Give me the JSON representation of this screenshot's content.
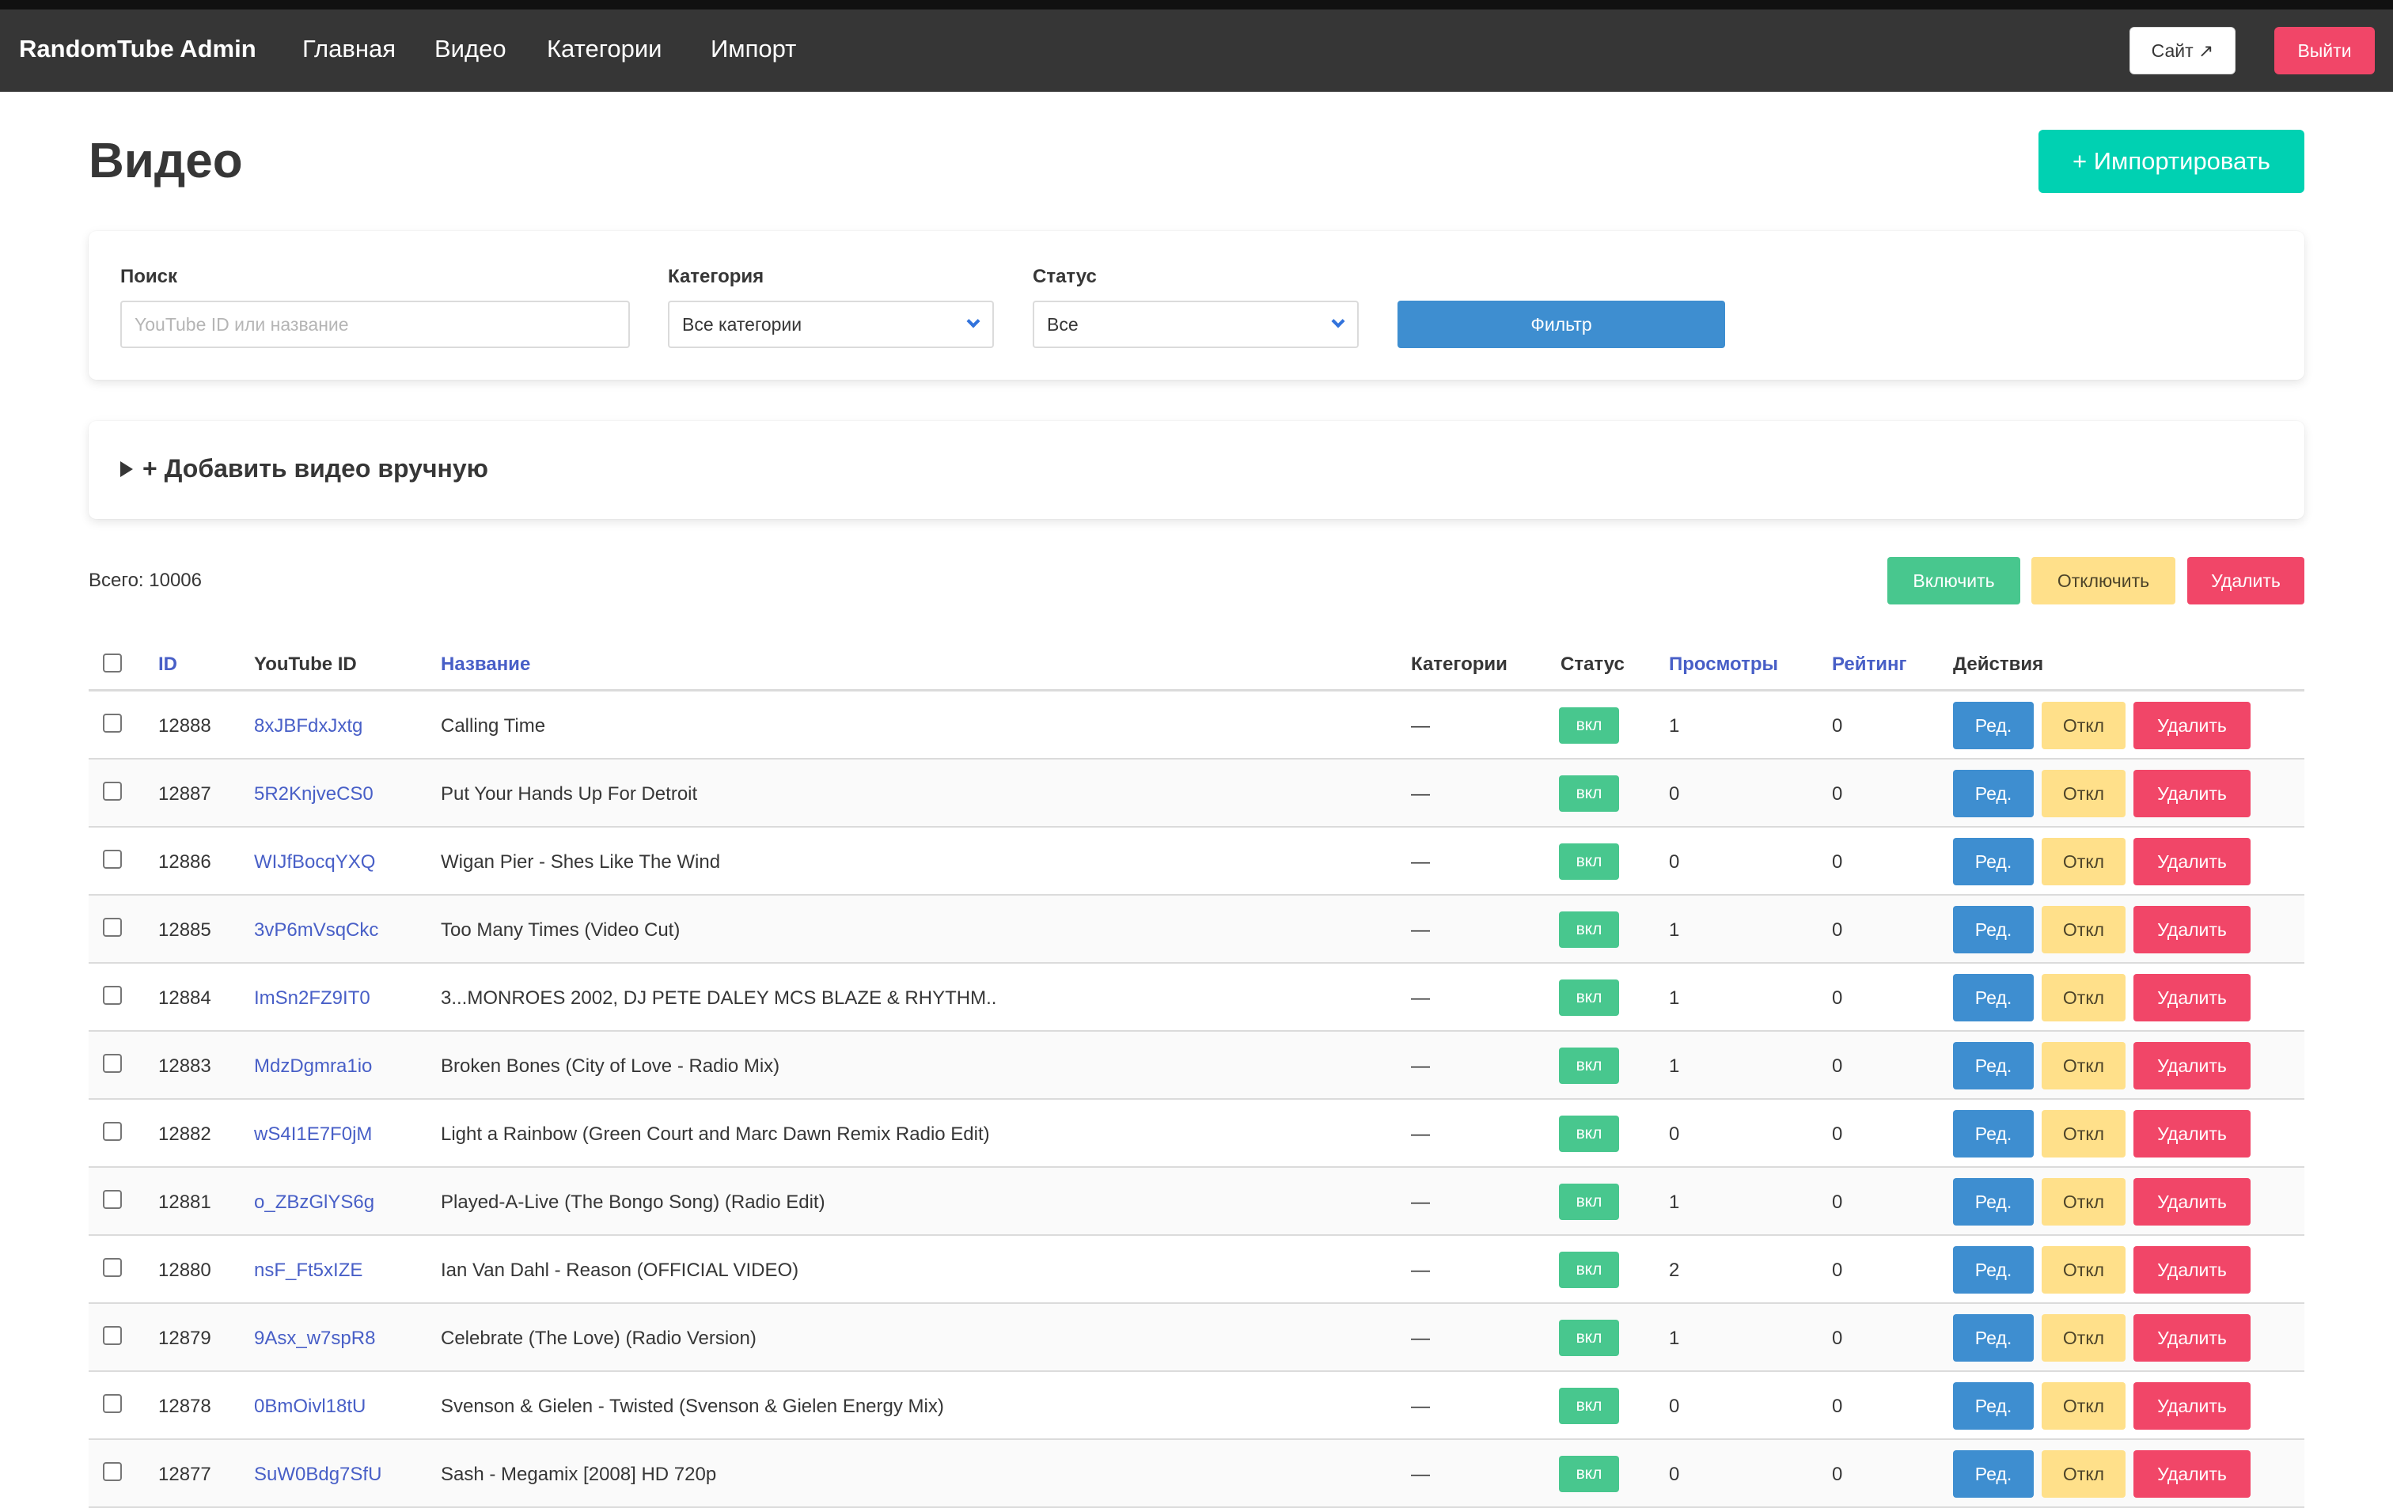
{
  "navbar": {
    "brand": "RandomTube Admin",
    "links": [
      "Главная",
      "Видео",
      "Категории",
      "Импорт"
    ],
    "site_button": "Сайт ↗",
    "logout_button": "Выйти"
  },
  "page": {
    "title": "Видео",
    "import_button": "+ Импортировать"
  },
  "filters": {
    "search_label": "Поиск",
    "search_placeholder": "YouTube ID или название",
    "category_label": "Категория",
    "category_value": "Все категории",
    "status_label": "Статус",
    "status_value": "Все",
    "filter_button": "Фильтр"
  },
  "add_manual": {
    "summary": "+ Добавить видео вручную"
  },
  "total": "Всего: 10006",
  "bulk": {
    "enable": "Включить",
    "disable": "Отключить",
    "delete": "Удалить"
  },
  "table": {
    "headers": {
      "id": "ID",
      "youtube_id": "YouTube ID",
      "title": "Название",
      "categories": "Категории",
      "status": "Статус",
      "views": "Просмотры",
      "rating": "Рейтинг",
      "actions": "Действия"
    },
    "action_labels": {
      "edit": "Ред.",
      "disable": "Откл",
      "delete": "Удалить"
    },
    "rows": [
      {
        "id": "12888",
        "yt": "8xJBFdxJxtg",
        "title": "Calling Time",
        "categories": "—",
        "status": "вкл",
        "views": "1",
        "rating": "0"
      },
      {
        "id": "12887",
        "yt": "5R2KnjveCS0",
        "title": "Put Your Hands Up For Detroit",
        "categories": "—",
        "status": "вкл",
        "views": "0",
        "rating": "0"
      },
      {
        "id": "12886",
        "yt": "WIJfBocqYXQ",
        "title": "Wigan Pier - Shes Like The Wind",
        "categories": "—",
        "status": "вкл",
        "views": "0",
        "rating": "0"
      },
      {
        "id": "12885",
        "yt": "3vP6mVsqCkc",
        "title": "Too Many Times (Video Cut)",
        "categories": "—",
        "status": "вкл",
        "views": "1",
        "rating": "0"
      },
      {
        "id": "12884",
        "yt": "ImSn2FZ9IT0",
        "title": "3...MONROES 2002, DJ PETE DALEY MCS BLAZE & RHYTHM..",
        "categories": "—",
        "status": "вкл",
        "views": "1",
        "rating": "0"
      },
      {
        "id": "12883",
        "yt": "MdzDgmra1io",
        "title": "Broken Bones (City of Love - Radio Mix)",
        "categories": "—",
        "status": "вкл",
        "views": "1",
        "rating": "0"
      },
      {
        "id": "12882",
        "yt": "wS4I1E7F0jM",
        "title": "Light a Rainbow (Green Court and Marc Dawn Remix Radio Edit)",
        "categories": "—",
        "status": "вкл",
        "views": "0",
        "rating": "0"
      },
      {
        "id": "12881",
        "yt": "o_ZBzGlYS6g",
        "title": "Played-A-Live (The Bongo Song) (Radio Edit)",
        "categories": "—",
        "status": "вкл",
        "views": "1",
        "rating": "0"
      },
      {
        "id": "12880",
        "yt": "nsF_Ft5xIZE",
        "title": "Ian Van Dahl - Reason (OFFICIAL VIDEO)",
        "categories": "—",
        "status": "вкл",
        "views": "2",
        "rating": "0"
      },
      {
        "id": "12879",
        "yt": "9Asx_w7spR8",
        "title": "Celebrate (The Love) (Radio Version)",
        "categories": "—",
        "status": "вкл",
        "views": "1",
        "rating": "0"
      },
      {
        "id": "12878",
        "yt": "0BmOivl18tU",
        "title": "Svenson & Gielen - Twisted (Svenson & Gielen Energy Mix)",
        "categories": "—",
        "status": "вкл",
        "views": "0",
        "rating": "0"
      },
      {
        "id": "12877",
        "yt": "SuW0Bdg7SfU",
        "title": "Sash - Megamix [2008] HD 720p",
        "categories": "—",
        "status": "вкл",
        "views": "0",
        "rating": "0"
      }
    ]
  }
}
